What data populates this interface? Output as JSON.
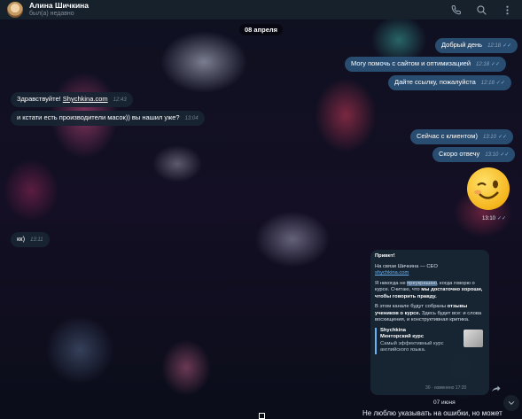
{
  "header": {
    "name": "Алина Шичкина",
    "status": "был(а) недавно",
    "icons": [
      "phone-icon",
      "search-icon",
      "more-vertical-icon"
    ]
  },
  "date_top": "08 апреля",
  "messages": [
    {
      "text": "Добрый день",
      "time": "12:18"
    },
    {
      "text": "Могу помочь с сайтом и оптимизацией",
      "time": "12:18"
    },
    {
      "text": "Дайте ссылку, пожалуйста",
      "time": "12:18"
    },
    {
      "prefix": "Здравствуйте! ",
      "link": "Shychkina.com",
      "time": "12:43"
    },
    {
      "text": "и кстати есть производители масок)) вы нашил уже?",
      "time": "13:04"
    },
    {
      "text": "Сейчас с клиентом)",
      "time": "13:10"
    },
    {
      "text": "Скоро отвечу",
      "time": "13:10"
    },
    {
      "text": "кк)",
      "time": "13:11"
    }
  ],
  "emoji_time": "13:10",
  "forwarded": {
    "greeting": "Привет!",
    "line1": "На связи Шичкина — CEO",
    "line1_link": "shychkina.com",
    "p2_a": "Я никогда не ",
    "p2_hl": "преукрашаю",
    "p2_b": ", когда говорю о курсе. Считаю, что ",
    "p2_bold": "мы достаточно хороши, чтобы говорить правду.",
    "p3_a": "В этом канале будут собраны ",
    "p3_bold": "отзывы учеников о курсе.",
    "p3_b": " Здесь будет все: и слова восхищения, и конструктивная критика.",
    "preview_site": "Shychkina",
    "preview_title": "Менторский курс",
    "preview_desc": "Самый эффективный курс английского языка.",
    "meta": "30 · изменено 17:20"
  },
  "date_bottom": "07 июня",
  "bottom_text": "Не люблю указывать на ошибки, но может",
  "colors": {
    "header_bg": "#17212b",
    "outgoing": "#2b5278",
    "incoming": "#182533",
    "link": "#6ab2f2"
  }
}
